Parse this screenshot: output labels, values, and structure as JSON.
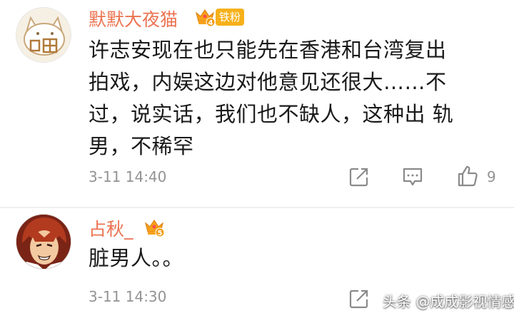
{
  "comments": [
    {
      "username": "默默大夜猫",
      "level": "4",
      "fan_badge": "铁粉",
      "text_lines": [
        "许志安现在也只能先在香港和台湾复出",
        "拍戏，内娱这边对他意见还很大……不",
        "过，说实话，我们也不缺人，这种出 轨",
        "男，不稀罕"
      ],
      "timestamp": "3-11 14:40",
      "like_count": "9"
    },
    {
      "username": "占秋_",
      "level": "5",
      "text": "脏男人。。",
      "timestamp": "3-11 14:30"
    }
  ],
  "watermark": "头条 @成成影视情感",
  "colors": {
    "username": "#eb7350",
    "badge": "#f6b11a",
    "crown": "#f7a21b",
    "muted": "#939393"
  },
  "icons": [
    "repost-icon",
    "reply-icon",
    "like-icon",
    "crown-icon"
  ]
}
